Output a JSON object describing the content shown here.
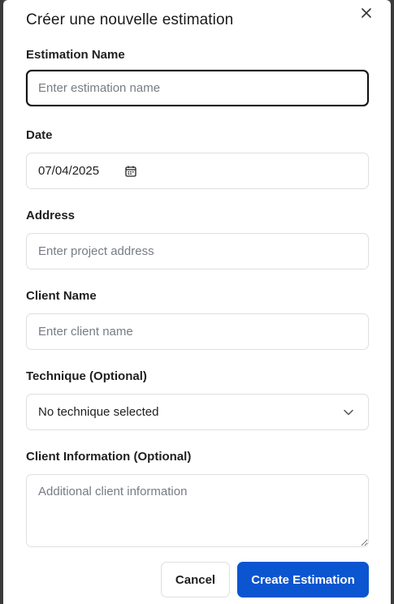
{
  "dialog": {
    "title": "Créer une nouvelle estimation",
    "close_icon": "close-icon"
  },
  "form": {
    "estimation_name": {
      "label": "Estimation Name",
      "placeholder": "Enter estimation name",
      "value": ""
    },
    "date": {
      "label": "Date",
      "value": "07/04/2025",
      "icon": "calendar-icon"
    },
    "address": {
      "label": "Address",
      "placeholder": "Enter project address",
      "value": ""
    },
    "client_name": {
      "label": "Client Name",
      "placeholder": "Enter client name",
      "value": ""
    },
    "technique": {
      "label": "Technique (Optional)",
      "selected": "No technique selected",
      "icon": "chevron-down-icon"
    },
    "client_information": {
      "label": "Client Information (Optional)",
      "placeholder": "Additional client information",
      "value": ""
    }
  },
  "actions": {
    "cancel_label": "Cancel",
    "create_label": "Create Estimation"
  },
  "colors": {
    "primary": "#0b55d0",
    "border": "#dcdfe4",
    "focus_border": "#111111"
  }
}
